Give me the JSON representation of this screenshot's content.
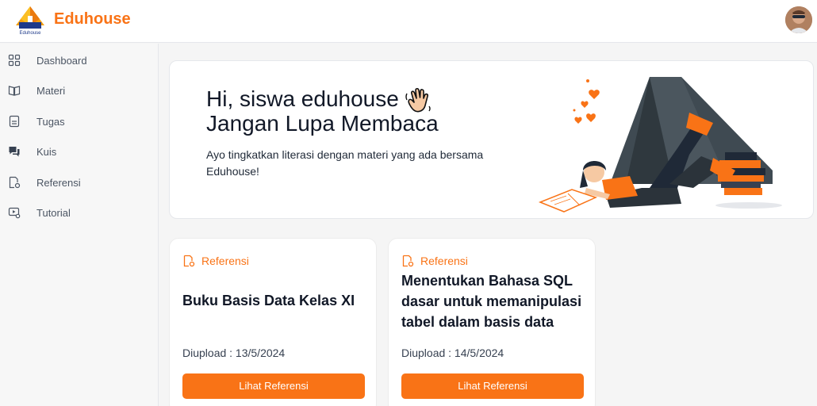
{
  "app": {
    "brand": "Eduhouse",
    "logo_caption": "Eduhouse"
  },
  "sidebar": {
    "items": [
      {
        "label": "Dashboard",
        "icon": "grid-icon"
      },
      {
        "label": "Materi",
        "icon": "book-open-icon"
      },
      {
        "label": "Tugas",
        "icon": "clipboard-icon"
      },
      {
        "label": "Kuis",
        "icon": "chat-icon"
      },
      {
        "label": "Referensi",
        "icon": "document-gear-icon"
      },
      {
        "label": "Tutorial",
        "icon": "video-gear-icon"
      }
    ]
  },
  "hero": {
    "greeting": "Hi, siswa eduhouse",
    "headline": "Jangan Lupa Membaca",
    "subtitle": "Ayo tingkatkan literasi dengan materi yang ada bersama Eduhouse!"
  },
  "cards": [
    {
      "tag": "Referensi",
      "title": "Buku Basis Data Kelas XI",
      "date": "Diupload : 13/5/2024",
      "button": "Lihat Referensi"
    },
    {
      "tag": "Referensi",
      "title": "Menentukan Bahasa SQL dasar untuk memanipulasi tabel dalam basis data",
      "date": "Diupload : 14/5/2024",
      "button": "Lihat Referensi"
    }
  ],
  "colors": {
    "accent": "#F97316",
    "text": "#111827",
    "muted": "#4B5563"
  }
}
